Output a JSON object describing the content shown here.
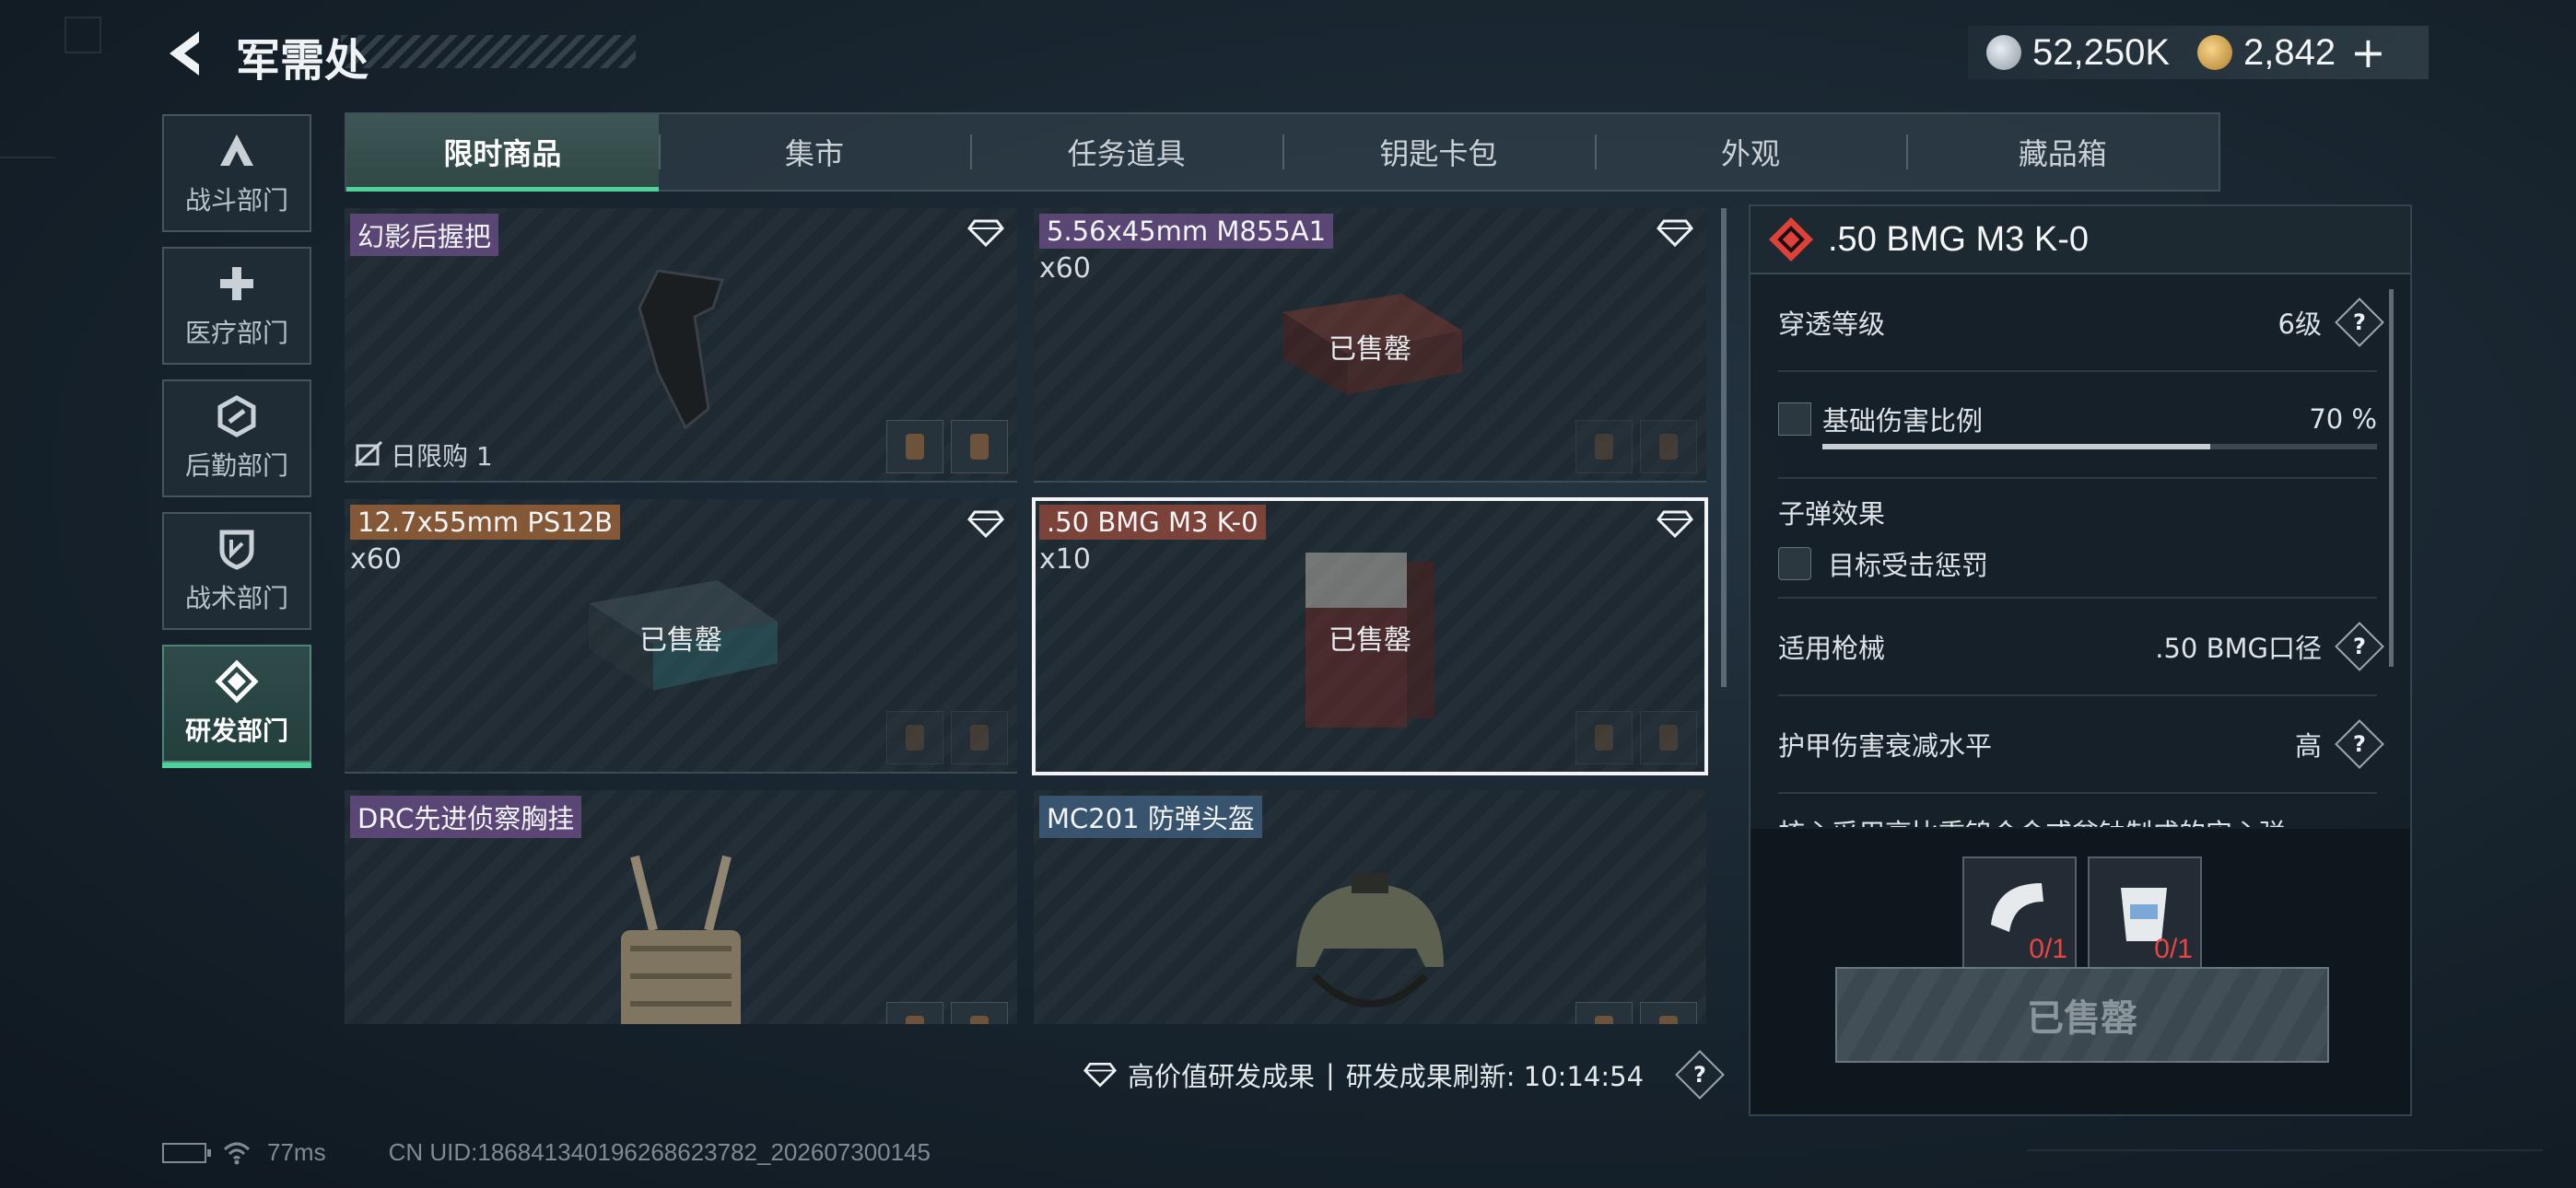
{
  "header": {
    "title": "军需处",
    "currency_silver": "52,250K",
    "currency_gold": "2,842",
    "plus_label": "+"
  },
  "departments": [
    {
      "label": "战斗部门",
      "icon": "combat-icon"
    },
    {
      "label": "医疗部门",
      "icon": "medical-cross-icon"
    },
    {
      "label": "后勤部门",
      "icon": "logistics-icon"
    },
    {
      "label": "战术部门",
      "icon": "shield-icon"
    },
    {
      "label": "研发部门",
      "icon": "research-icon",
      "active": true
    }
  ],
  "tabs": [
    {
      "label": "限时商品",
      "active": true
    },
    {
      "label": "集市"
    },
    {
      "label": "任务道具"
    },
    {
      "label": "钥匙卡包"
    },
    {
      "label": "外观"
    },
    {
      "label": "藏品箱"
    }
  ],
  "items": [
    {
      "name": "幻影后握把",
      "qty": "",
      "sold": "",
      "limit": "日限购 1",
      "color": "purple"
    },
    {
      "name": "5.56x45mm M855A1",
      "qty": "x60",
      "sold": "已售罄",
      "limit": "",
      "color": "purple"
    },
    {
      "name": "12.7x55mm PS12B",
      "qty": "x60",
      "sold": "已售罄",
      "limit": "",
      "color": "orange"
    },
    {
      "name": ".50 BMG M3 K-0",
      "qty": "x10",
      "sold": "已售罄",
      "limit": "",
      "color": "red",
      "selected": true
    },
    {
      "name": "DRC先进侦察胸挂",
      "qty": "",
      "sold": "",
      "limit": "",
      "color": "purple"
    },
    {
      "name": "MC201 防弹头盔",
      "qty": "",
      "sold": "",
      "limit": "",
      "color": "blue"
    }
  ],
  "footer": {
    "high_value_label": "高价值研发成果",
    "separator": "|",
    "refresh_label": "研发成果刷新: 10:14:54",
    "help": "?"
  },
  "status": {
    "ping": "77ms",
    "uid": "CN UID:18684134019626862378​2_202607300145"
  },
  "detail": {
    "title": ".50 BMG M3 K-0",
    "penetration_label": "穿透等级",
    "penetration_value": "6级",
    "damage_label": "基础伤害比例",
    "damage_value": "70 %",
    "damage_ratio": 0.7,
    "bullet_effect_label": "子弹效果",
    "bullet_effect_value": "目标受击惩罚",
    "weapon_label": "适用枪械",
    "weapon_value": ".50 BMG口径",
    "armor_label": "护甲伤害衰减水平",
    "armor_value": "高",
    "description": "核心采用高比重钨合金或贫铀制成的实心弹",
    "req1": "0/1",
    "req2": "0/1",
    "buy_label": "已售罄",
    "help": "?"
  },
  "colors": {
    "accent": "#4fd19a",
    "diamond": "#e0403a",
    "requirement": "#e94545"
  }
}
